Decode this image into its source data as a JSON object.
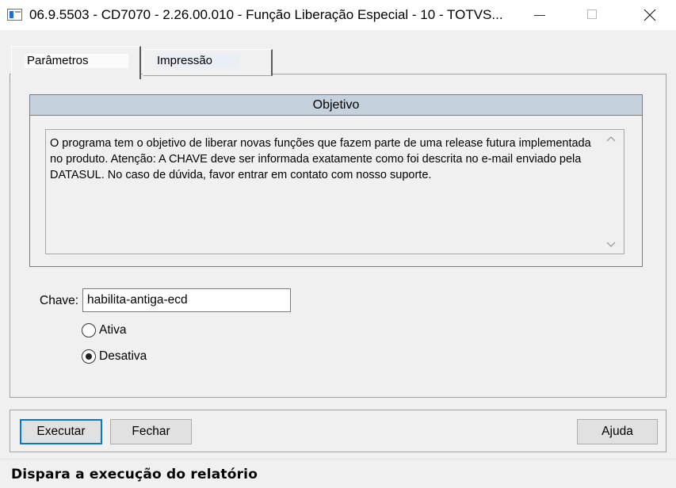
{
  "window": {
    "title": "06.9.5503 - CD7070 - 2.26.00.010 - Função Liberação Especial - 10 - TOTVS...",
    "minimize_glyph": "—",
    "maximize_glyph": "☐",
    "close_glyph": "✕"
  },
  "tabs": [
    {
      "label": "Parâmetros",
      "active": true
    },
    {
      "label": "Impressão",
      "active": false
    }
  ],
  "objetivo": {
    "header": "Objetivo",
    "text": "O programa tem o objetivo de liberar novas funções que fazem parte de uma release futura implementada no produto. Atenção: A CHAVE deve ser informada exatamente como foi descrita no e-mail enviado pela DATASUL. No caso de dúvida, favor entrar em contato com nosso suporte."
  },
  "chave": {
    "label": "Chave:",
    "value": "habilita-antiga-ecd"
  },
  "radios": [
    {
      "label": "Ativa",
      "selected": false
    },
    {
      "label": "Desativa",
      "selected": true
    }
  ],
  "buttons": {
    "executar": "Executar",
    "fechar": "Fechar",
    "ajuda": "Ajuda"
  },
  "status": {
    "text": "Dispara a execução do relatório"
  },
  "colors": {
    "focus_border": "#0078d7",
    "group_header_bg": "#c5d1dc",
    "window_bg": "#f0f0f0"
  }
}
